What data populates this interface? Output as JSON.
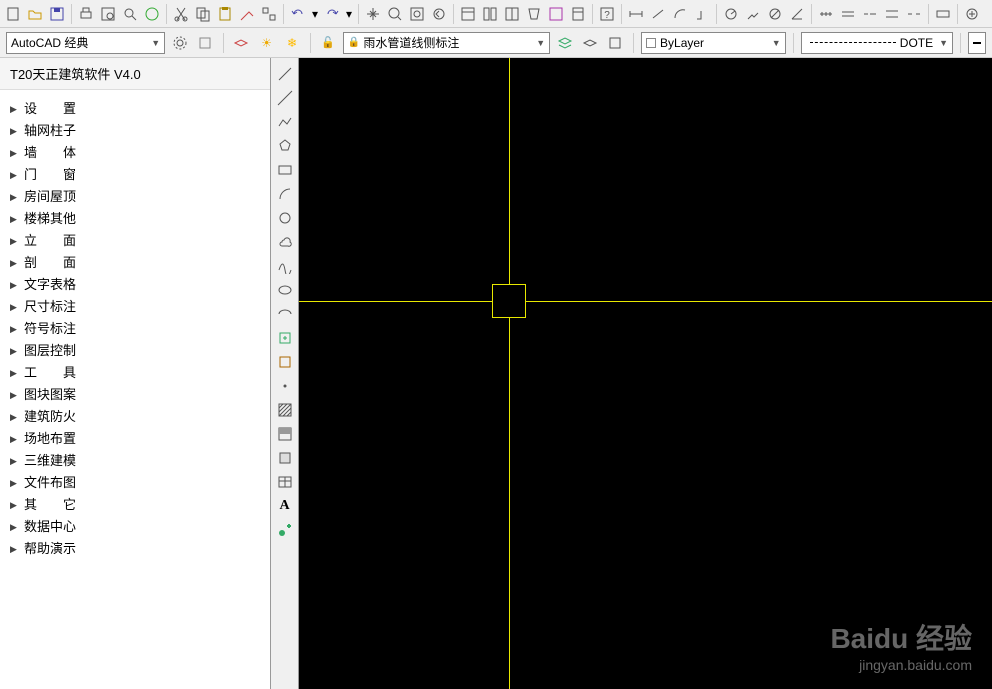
{
  "toolbar2": {
    "workspace": "AutoCAD 经典",
    "layer_label": "雨水管道线侧标注",
    "layer_name": "ByLayer",
    "linetype": "DOTE"
  },
  "panel": {
    "title": "T20天正建筑软件 V4.0",
    "items": [
      "设　　置",
      "轴网柱子",
      "墙　　体",
      "门　　窗",
      "房间屋顶",
      "楼梯其他",
      "立　　面",
      "剖　　面",
      "文字表格",
      "尺寸标注",
      "符号标注",
      "图层控制",
      "工　　具",
      "图块图案",
      "建筑防火",
      "场地布置",
      "三维建模",
      "文件布图",
      "其　　它",
      "数据中心",
      "帮助演示"
    ]
  },
  "watermark": {
    "logo": "Baidu 经验",
    "url": "jingyan.baidu.com"
  }
}
